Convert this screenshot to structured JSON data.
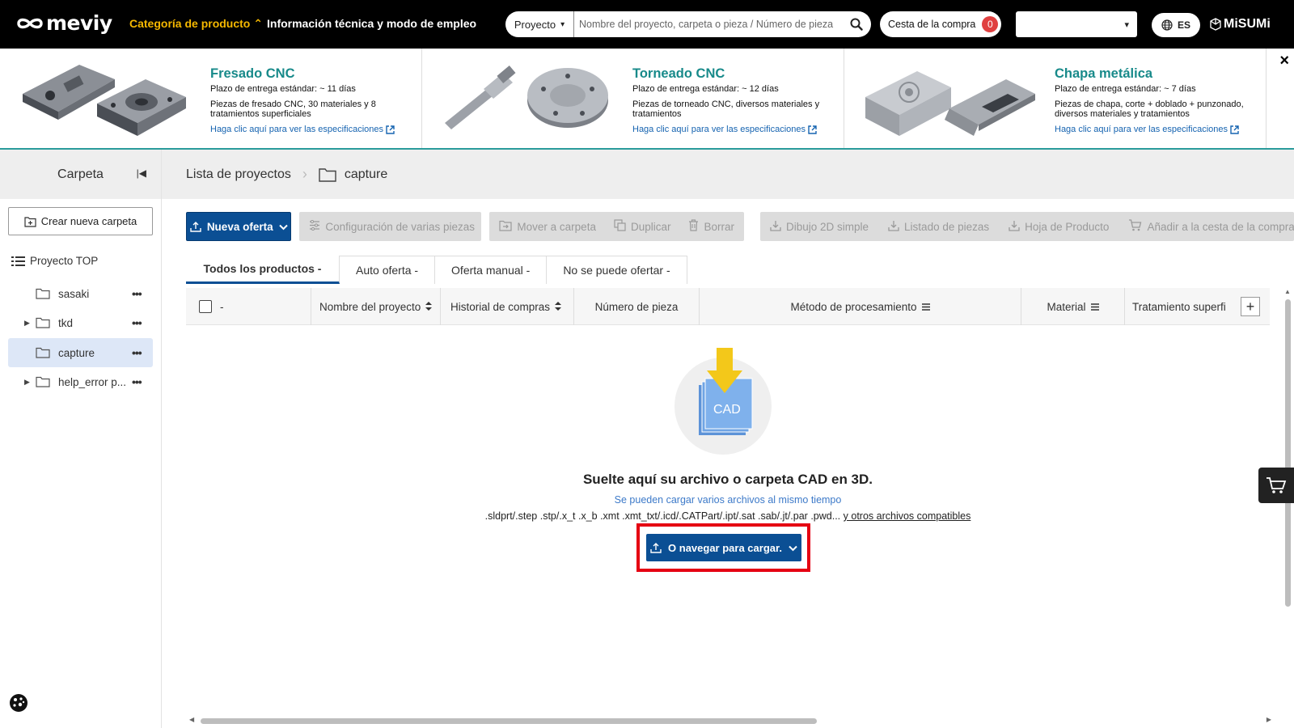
{
  "header": {
    "logo": "meviy",
    "nav_category": "Categoría de producto ⌃",
    "nav_info": "Información técnica y modo de empleo",
    "search_scope": "Proyecto",
    "search_placeholder": "Nombre del proyecto, carpeta o pieza / Número de pieza",
    "cart_label": "Cesta de la compra",
    "cart_count": "0",
    "account_value": "",
    "language": "ES",
    "brand": "MiSUMi"
  },
  "banner": {
    "promos": [
      {
        "title": "Fresado CNC",
        "lead": "Plazo de entrega estándar: ~ 11 días",
        "desc": "Piezas de fresado CNC, 30 materiales y 8 tratamientos superficiales",
        "link": "Haga clic aquí para ver las especificaciones"
      },
      {
        "title": "Torneado CNC",
        "lead": "Plazo de entrega estándar: ~ 12 días",
        "desc": "Piezas de torneado CNC, diversos materiales y tratamientos",
        "link": "Haga clic aquí para ver las especificaciones"
      },
      {
        "title": "Chapa metálica",
        "lead": "Plazo de entrega estándar: ~ 7 días",
        "desc": "Piezas de chapa, corte + doblado + punzonado, diversos materiales y tratamientos",
        "link": "Haga clic aquí para ver las especificaciones"
      }
    ],
    "close": "×"
  },
  "sidebar": {
    "title": "Carpeta",
    "new_folder": "Crear nueva carpeta",
    "root": "Proyecto TOP",
    "items": [
      {
        "label": "sasaki",
        "dots": "•••"
      },
      {
        "label": "tkd",
        "dots": "•••"
      },
      {
        "label": "capture",
        "dots": "•••"
      },
      {
        "label": "help_error p...",
        "dots": "•••"
      }
    ]
  },
  "breadcrumb": {
    "root": "Lista de proyectos",
    "separator": "›",
    "current": "capture"
  },
  "toolbar": {
    "new_quote": "Nueva oferta",
    "multi_config": "Configuración de varias piezas",
    "move": "Mover a carpeta",
    "duplicate": "Duplicar",
    "delete": "Borrar",
    "drawing": "Dibujo 2D simple",
    "parts_list": "Listado de piezas",
    "product_sheet": "Hoja de Producto",
    "add_to_cart": "Añadir a la cesta de la compra"
  },
  "tabs": [
    {
      "label": "Todos los productos -"
    },
    {
      "label": "Auto oferta -"
    },
    {
      "label": "Oferta manual -"
    },
    {
      "label": "No se puede ofertar -"
    }
  ],
  "table": {
    "select_label": "-",
    "columns": [
      "Nombre del proyecto",
      "Historial de compras",
      "Número de pieza",
      "Método de procesamiento",
      "Material",
      "Tratamiento superfi"
    ]
  },
  "dropzone": {
    "icon_label": "CAD",
    "title": "Suelte aquí su archivo o carpeta CAD en 3D.",
    "subtitle": "Se pueden cargar varios archivos al mismo tiempo",
    "formats": ".sldprt/.step .stp/.x_t .x_b .xmt .xmt_txt/.icd/.CATPart/.ipt/.sat .sab/.jt/.par .pwd...",
    "formats_link": "y otros archivos compatibles",
    "browse": "O navegar para cargar."
  },
  "colors": {
    "accent": "#0b4f94",
    "brand_yellow": "#f5b800",
    "teal": "#188a8a",
    "highlight": "#e50012"
  }
}
